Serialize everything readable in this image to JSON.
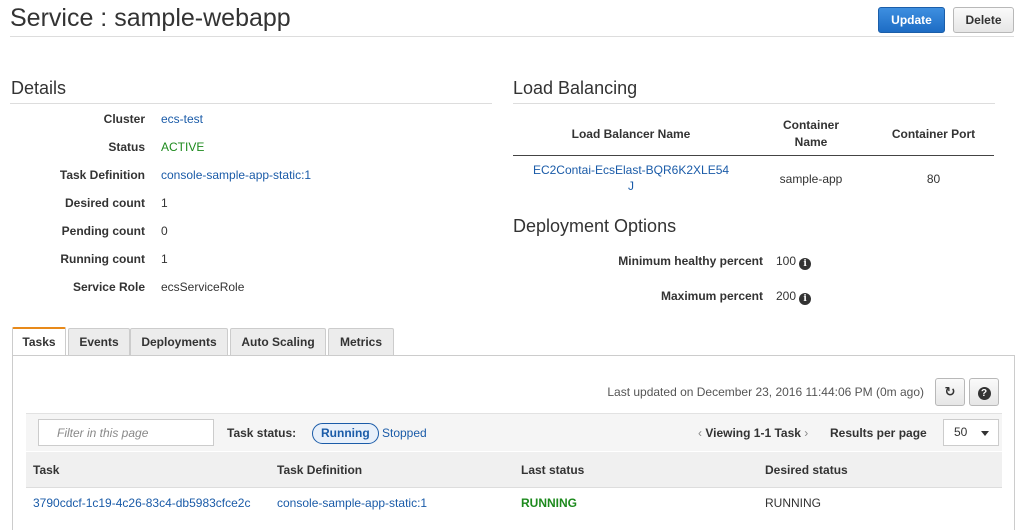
{
  "header": {
    "title": "Service : sample-webapp",
    "update_label": "Update",
    "delete_label": "Delete"
  },
  "details": {
    "title": "Details",
    "rows": [
      {
        "label": "Cluster",
        "value": "ecs-test"
      },
      {
        "label": "Status",
        "value": "ACTIVE"
      },
      {
        "label": "Task Definition",
        "value": "console-sample-app-static:1"
      },
      {
        "label": "Desired count",
        "value": "1"
      },
      {
        "label": "Pending count",
        "value": "0"
      },
      {
        "label": "Running count",
        "value": "1"
      },
      {
        "label": "Service Role",
        "value": "ecsServiceRole"
      }
    ]
  },
  "load_balancing": {
    "title": "Load Balancing",
    "headers": [
      "Load Balancer Name",
      "Container Name",
      "Container Port"
    ],
    "row": {
      "lb_name_line1": "EC2Contai-EcsElast-BQR6K2XLE54",
      "lb_name_line2": "J",
      "container_name": "sample-app",
      "container_port": "80"
    }
  },
  "deployment": {
    "title": "Deployment Options",
    "min_label": "Minimum healthy percent",
    "min_value": "100",
    "max_label": "Maximum percent",
    "max_value": "200"
  },
  "tabs": [
    "Tasks",
    "Events",
    "Deployments",
    "Auto Scaling",
    "Metrics"
  ],
  "tasks": {
    "last_updated": "Last updated on December 23, 2016 11:44:06 PM (0m ago)",
    "filter_placeholder": "Filter in this page",
    "task_status_label": "Task status:",
    "running_label": "Running",
    "stopped_label": "Stopped",
    "viewing_label": "Viewing 1-1 Task",
    "per_page_label": "Results per page",
    "per_page_value": "50",
    "columns": [
      "Task",
      "Task Definition",
      "Last status",
      "Desired status"
    ],
    "rows": [
      {
        "task": "3790cdcf-1c19-4c26-83c4-db5983cfce2c",
        "task_definition": "console-sample-app-static:1",
        "last_status": "RUNNING",
        "desired_status": "RUNNING"
      }
    ]
  },
  "colors": {
    "primary": "#1d6cc4",
    "link": "#1a5ba8",
    "active_green": "#1d8a1d",
    "tab_accent": "#e88a1a"
  },
  "icons": {
    "refresh": "refresh-icon",
    "help": "help-icon",
    "info": "info-icon",
    "filter": "funnel-icon"
  }
}
